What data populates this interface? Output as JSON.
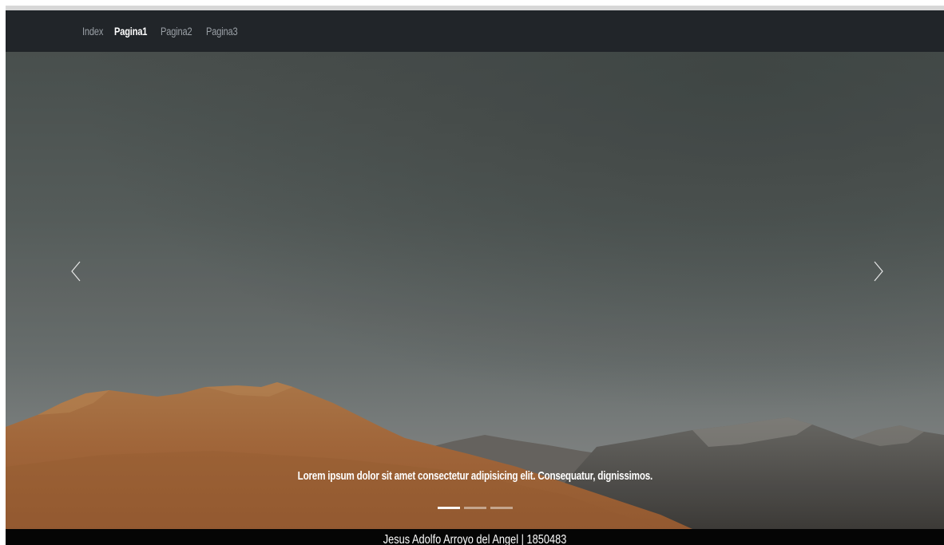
{
  "nav": {
    "links": [
      {
        "label": "Index",
        "active": false
      },
      {
        "label": "Pagina1",
        "active": true
      },
      {
        "label": "Pagina2",
        "active": false
      },
      {
        "label": "Pagina3",
        "active": false
      }
    ]
  },
  "carousel": {
    "prev_icon": "chevron-left-icon",
    "next_icon": "chevron-right-icon",
    "caption": "Lorem ipsum dolor sit amet consectetur adipisicing elit. Consequatur, dignissimos.",
    "active_slide": 1,
    "slide_count": 3
  },
  "footer": {
    "text": "Jesus Adolfo Arroyo del Angel | 1850483"
  },
  "colors": {
    "navbar": "#212529",
    "footer": "#050505",
    "nav_inactive": "#9aa0a6",
    "nav_active": "#ffffff"
  }
}
